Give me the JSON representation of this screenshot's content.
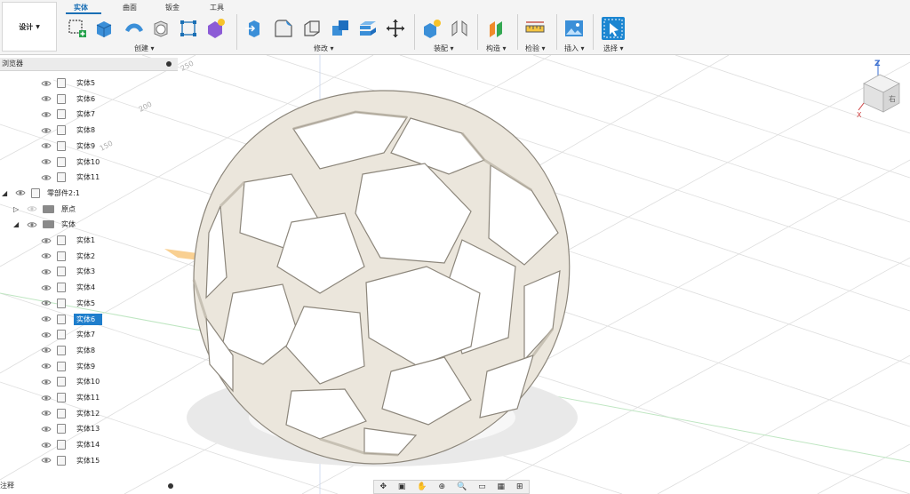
{
  "workspace": {
    "label": "设计",
    "caret": "▼"
  },
  "tabs": [
    {
      "label": "实体",
      "active": true
    },
    {
      "label": "曲面",
      "active": false
    },
    {
      "label": "钣金",
      "active": false
    },
    {
      "label": "工具",
      "active": false
    }
  ],
  "groups": {
    "create": "创建 ▾",
    "modify": "修改 ▾",
    "assemble": "装配 ▾",
    "construct": "构造 ▾",
    "inspect": "检验 ▾",
    "insert": "插入 ▾",
    "select": "选择 ▾"
  },
  "browser": {
    "title": "浏览器",
    "top_bodies": [
      "实体5",
      "实体6",
      "实体7",
      "实体8",
      "实体9",
      "实体10",
      "实体11"
    ],
    "component": "零部件2:1",
    "origin": "原点",
    "bodies_folder": "实体",
    "bodies": [
      "实体1",
      "实体2",
      "实体3",
      "实体4",
      "实体5",
      "实体6",
      "实体7",
      "实体8",
      "实体9",
      "实体10",
      "实体11",
      "实体12",
      "实体13",
      "实体14",
      "实体15"
    ],
    "selected_body": "实体6"
  },
  "timeline": {
    "label": "注释"
  },
  "grid_numbers": [
    "250",
    "200",
    "150"
  ],
  "viewcube": {
    "z_label": "Z",
    "x_label": "X",
    "face_label": "右"
  },
  "colors": {
    "accent": "#1a6fb5",
    "selection": "#1f7ecc",
    "plane_orange": "#f5b04a",
    "frame_face": "#cfc8bd",
    "frame_inner": "#ebe6dc"
  }
}
